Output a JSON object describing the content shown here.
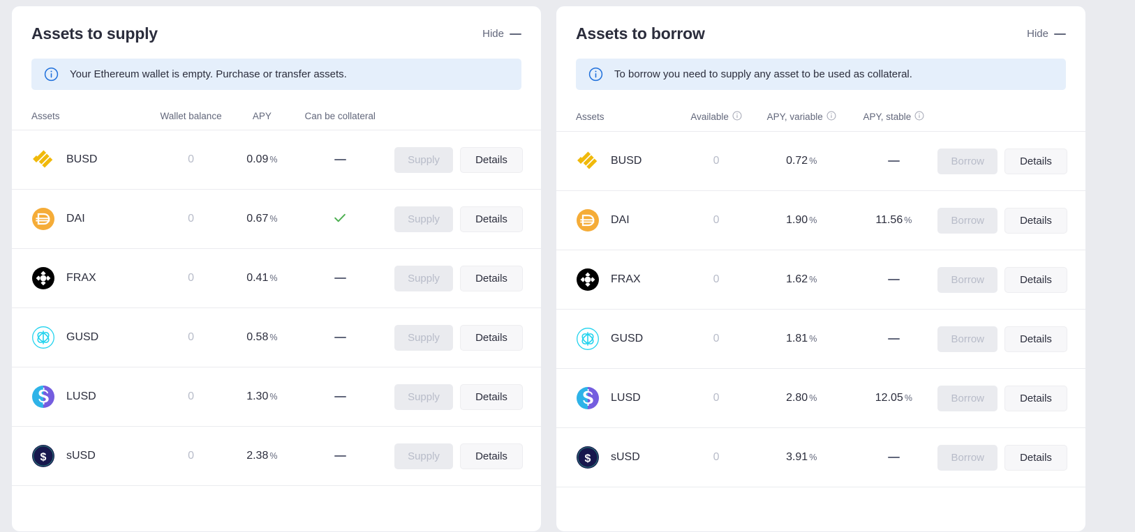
{
  "panels": [
    {
      "id": "supply",
      "title": "Assets to supply",
      "hide_label": "Hide",
      "hide_icon": "minus-icon",
      "notice": {
        "icon": "info-circle-icon",
        "text": "Your Ethereum wallet is empty. Purchase or transfer assets."
      },
      "columns": [
        {
          "label": "Assets",
          "info": false
        },
        {
          "label": "Wallet balance",
          "info": false
        },
        {
          "label": "APY",
          "info": false
        },
        {
          "label": "Can be collateral",
          "info": false
        }
      ],
      "action_label": "Supply",
      "details_label": "Details",
      "rows": [
        {
          "icon": "busd-icon",
          "asset": "BUSD",
          "balance": "0",
          "apy": "0.09",
          "apy_symbol": "%",
          "collateral": "dash"
        },
        {
          "icon": "dai-icon",
          "asset": "DAI",
          "balance": "0",
          "apy": "0.67",
          "apy_symbol": "%",
          "collateral": "check"
        },
        {
          "icon": "frax-icon",
          "asset": "FRAX",
          "balance": "0",
          "apy": "0.41",
          "apy_symbol": "%",
          "collateral": "dash"
        },
        {
          "icon": "gusd-icon",
          "asset": "GUSD",
          "balance": "0",
          "apy": "0.58",
          "apy_symbol": "%",
          "collateral": "dash"
        },
        {
          "icon": "lusd-icon",
          "asset": "LUSD",
          "balance": "0",
          "apy": "1.30",
          "apy_symbol": "%",
          "collateral": "dash"
        },
        {
          "icon": "susd-icon",
          "asset": "sUSD",
          "balance": "0",
          "apy": "2.38",
          "apy_symbol": "%",
          "collateral": "dash"
        }
      ]
    },
    {
      "id": "borrow",
      "title": "Assets to borrow",
      "hide_label": "Hide",
      "hide_icon": "minus-icon",
      "notice": {
        "icon": "info-circle-icon",
        "text": "To borrow you need to supply any asset to be used as collateral."
      },
      "columns": [
        {
          "label": "Assets",
          "info": false
        },
        {
          "label": "Available",
          "info": true
        },
        {
          "label": "APY, variable",
          "info": true
        },
        {
          "label": "APY, stable",
          "info": true
        }
      ],
      "action_label": "Borrow",
      "details_label": "Details",
      "rows": [
        {
          "icon": "busd-icon",
          "asset": "BUSD",
          "available": "0",
          "apy_variable": "0.72",
          "apy_stable": "dash",
          "apy_symbol": "%"
        },
        {
          "icon": "dai-icon",
          "asset": "DAI",
          "available": "0",
          "apy_variable": "1.90",
          "apy_stable": "11.56",
          "apy_symbol": "%"
        },
        {
          "icon": "frax-icon",
          "asset": "FRAX",
          "available": "0",
          "apy_variable": "1.62",
          "apy_stable": "dash",
          "apy_symbol": "%"
        },
        {
          "icon": "gusd-icon",
          "asset": "GUSD",
          "available": "0",
          "apy_variable": "1.81",
          "apy_stable": "dash",
          "apy_symbol": "%"
        },
        {
          "icon": "lusd-icon",
          "asset": "LUSD",
          "available": "0",
          "apy_variable": "2.80",
          "apy_stable": "12.05",
          "apy_symbol": "%"
        },
        {
          "icon": "susd-icon",
          "asset": "sUSD",
          "available": "0",
          "apy_variable": "3.91",
          "apy_stable": "dash",
          "apy_symbol": "%"
        }
      ]
    }
  ],
  "colors": {
    "page_background": "#eaebef",
    "panel_background": "#ffffff",
    "notice_background": "#e5effb",
    "notice_icon": "#1e6fdb",
    "text_primary": "#2b2d3c",
    "text_muted": "#62677b",
    "text_disabled": "#b8bcc9",
    "check_green": "#4caf50",
    "busd_yellow": "#f0b90b",
    "dai_orange": "#f5ac37",
    "frax_black": "#000000",
    "gusd_cyan": "#22d3ee",
    "lusd_blue": "#2eb3e8",
    "lusd_purple": "#745ddf",
    "susd_navy": "#17174d"
  }
}
